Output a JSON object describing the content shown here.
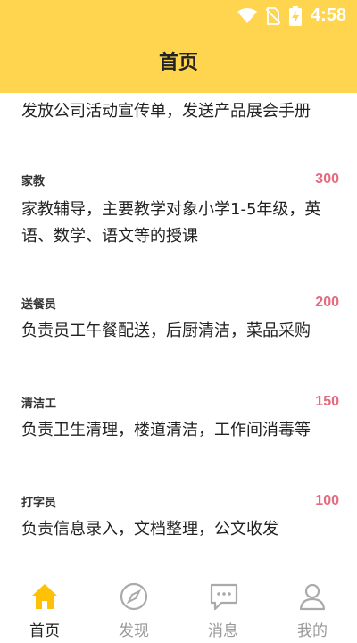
{
  "status": {
    "time": "4:58",
    "icons": [
      "wifi-icon",
      "no-sim-icon",
      "battery-charging-icon"
    ]
  },
  "header": {
    "title": "首页"
  },
  "partial_item": {
    "desc": "发放公司活动宣传单，发送产品展会手册"
  },
  "jobs": [
    {
      "title": "家教",
      "pay": "300",
      "desc": "家教辅导，主要教学对象小学1-5年级，英语、数学、语文等的授课"
    },
    {
      "title": "送餐员",
      "pay": "200",
      "desc": "负责员工午餐配送，后厨清洁，菜品采购"
    },
    {
      "title": "清洁工",
      "pay": "150",
      "desc": "负责卫生清理，楼道清洁，工作间消毒等"
    },
    {
      "title": "打字员",
      "pay": "100",
      "desc": "负责信息录入，文档整理，公文收发"
    }
  ],
  "tabs": [
    {
      "label": "首页",
      "icon": "home-icon",
      "active": true
    },
    {
      "label": "发现",
      "icon": "compass-icon",
      "active": false
    },
    {
      "label": "消息",
      "icon": "message-icon",
      "active": false
    },
    {
      "label": "我的",
      "icon": "user-icon",
      "active": false
    }
  ],
  "colors": {
    "header": "#FFD54F",
    "pay": "#E56A7E",
    "active_tab": "#FFC107"
  }
}
